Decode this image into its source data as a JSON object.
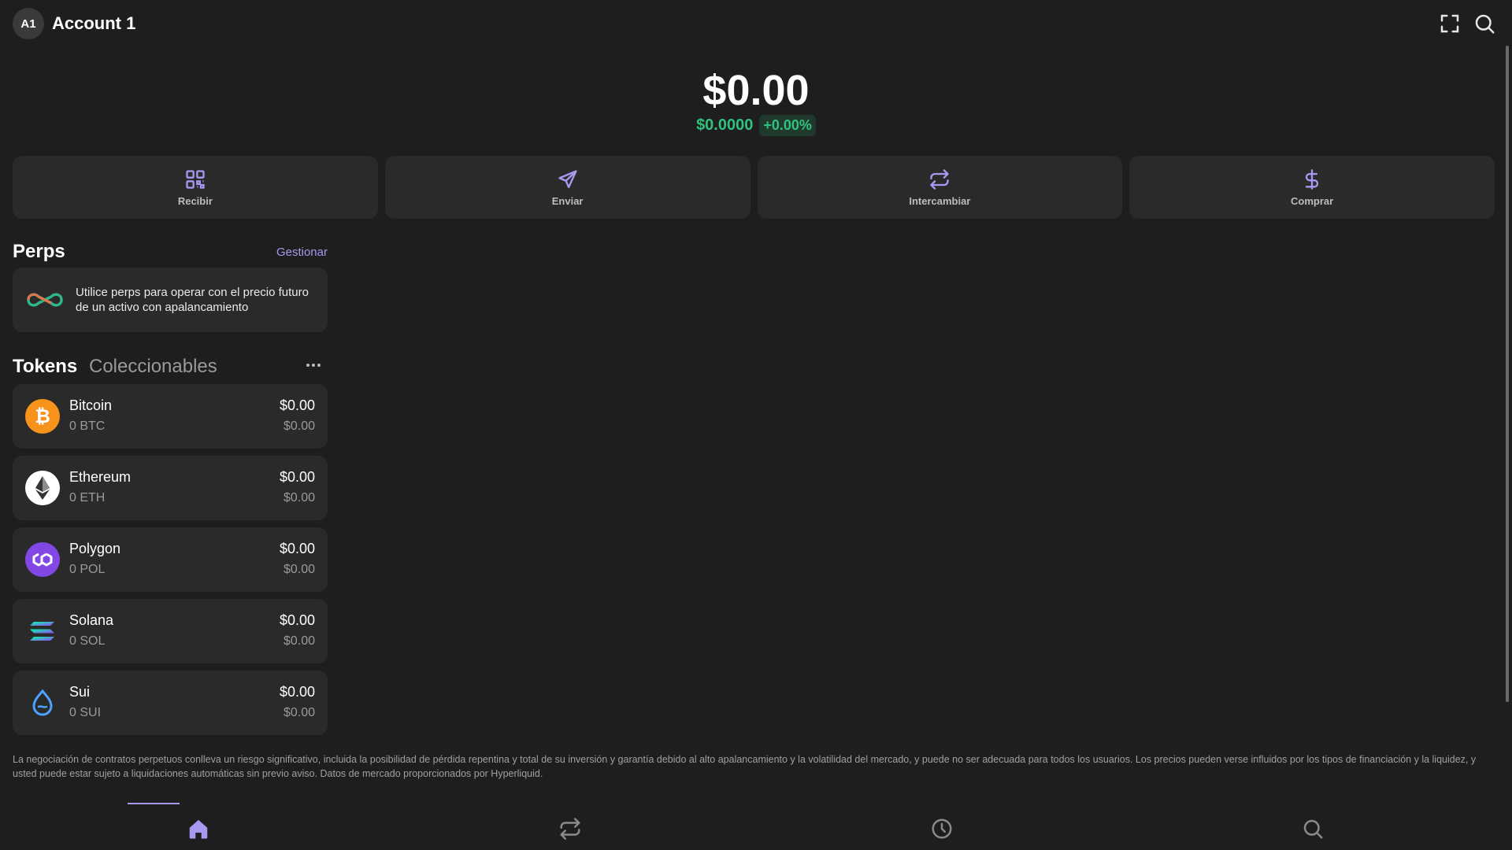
{
  "header": {
    "avatar_initials": "A1",
    "account_name": "Account 1",
    "icons": [
      "expand-icon",
      "search-icon"
    ]
  },
  "balance": {
    "total": "$0.00",
    "change_value": "$0.0000",
    "change_percent": "+0.00%",
    "positive_color": "#2ec27e"
  },
  "actions": [
    {
      "label": "Recibir",
      "icon": "qr-code-icon"
    },
    {
      "label": "Enviar",
      "icon": "send-icon"
    },
    {
      "label": "Intercambiar",
      "icon": "swap-icon"
    },
    {
      "label": "Comprar",
      "icon": "dollar-icon"
    }
  ],
  "perps": {
    "title": "Perps",
    "manage_label": "Gestionar",
    "description": "Utilice perps para operar con el precio futuro de un activo con apalancamiento"
  },
  "tabs": {
    "active": "Tokens",
    "inactive": "Coleccionables"
  },
  "tokens": [
    {
      "name": "Bitcoin",
      "amount": "0 BTC",
      "value": "$0.00",
      "value2": "$0.00",
      "icon": "bitcoin-icon"
    },
    {
      "name": "Ethereum",
      "amount": "0 ETH",
      "value": "$0.00",
      "value2": "$0.00",
      "icon": "ethereum-icon"
    },
    {
      "name": "Polygon",
      "amount": "0 POL",
      "value": "$0.00",
      "value2": "$0.00",
      "icon": "polygon-icon"
    },
    {
      "name": "Solana",
      "amount": "0 SOL",
      "value": "$0.00",
      "value2": "$0.00",
      "icon": "solana-icon"
    },
    {
      "name": "Sui",
      "amount": "0 SUI",
      "value": "$0.00",
      "value2": "$0.00",
      "icon": "sui-icon"
    }
  ],
  "disclaimer": "La negociación de contratos perpetuos conlleva un riesgo significativo, incluida la posibilidad de pérdida repentina y total de su inversión y garantía debido al alto apalancamiento y la volatilidad del mercado, y puede no ser adecuada para todos los usuarios. Los precios pueden verse influidos por los tipos de financiación y la liquidez, y usted puede estar sujeto a liquidaciones automáticas sin previo aviso. Datos de mercado proporcionados por Hyperliquid.",
  "bottom_nav": {
    "items": [
      "home-icon",
      "swap-icon",
      "history-icon",
      "search-icon"
    ],
    "active": "home-icon",
    "accent_color": "#a998f0"
  }
}
